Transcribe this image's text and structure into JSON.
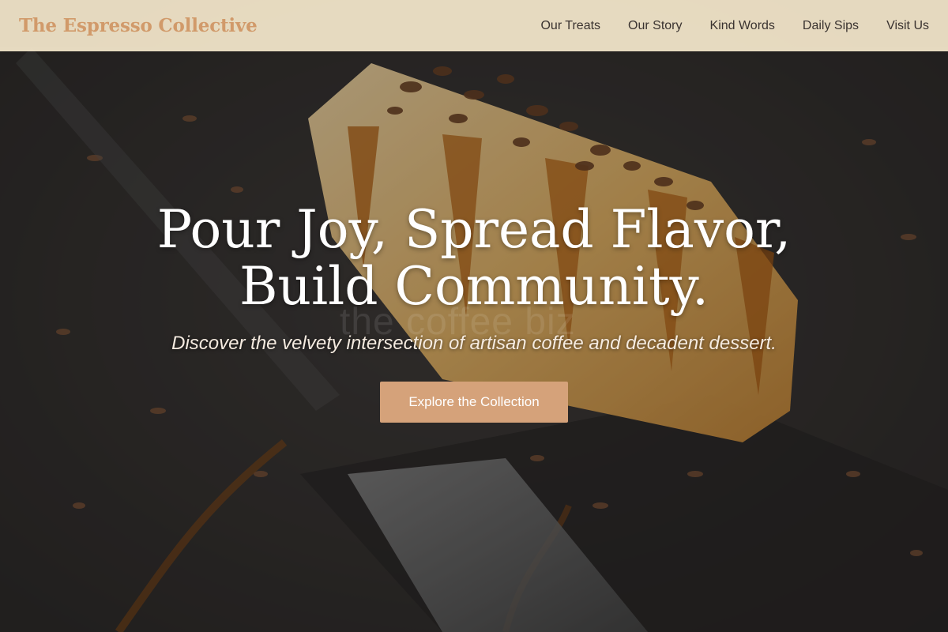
{
  "navbar": {
    "brand": "The Espresso Collective",
    "links": [
      "Our Treats",
      "Our Story",
      "Kind Words",
      "Daily Sips",
      "Visit Us"
    ]
  },
  "hero": {
    "headline_line1": "Pour Joy, Spread Flavor,",
    "headline_line2": "Build Community.",
    "tagline": "Discover the velvety intersection of artisan coffee and decadent dessert.",
    "cta_label": "Explore the Collection",
    "watermark": "the coffee biz"
  },
  "colors": {
    "brand": "#d19a6a",
    "navbar_bg": "#f5e8cc",
    "cta_bg": "#d5a27a",
    "headline": "#ffffff"
  }
}
